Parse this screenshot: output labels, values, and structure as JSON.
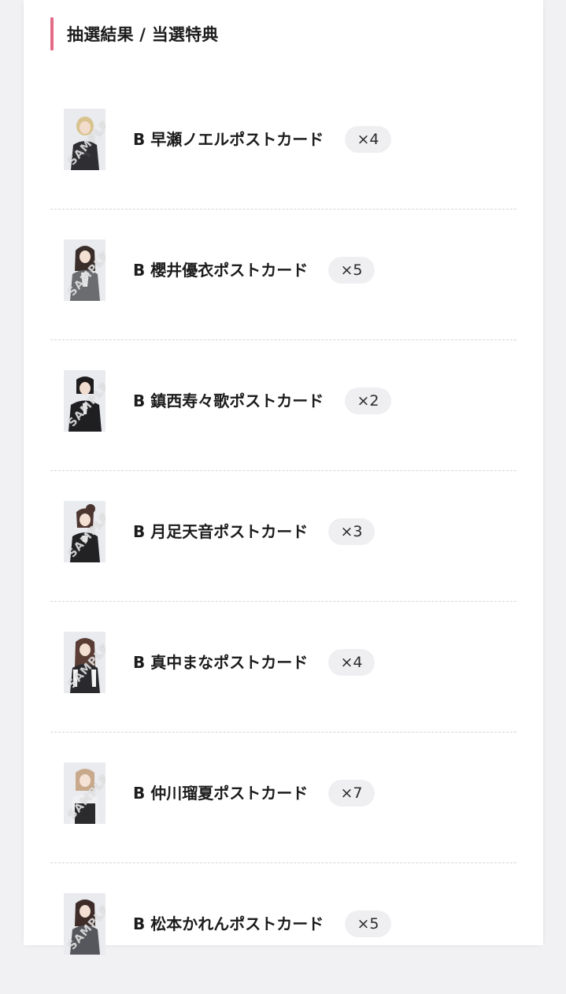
{
  "section": {
    "title": "抽選結果 / 当選特典",
    "accent_color": "#e46b86"
  },
  "items": [
    {
      "name": "B 早瀬ノエルポストカード",
      "quantity": "×4",
      "watermark": "SAMPLE",
      "photo_icon": "member-photo"
    },
    {
      "name": "B 櫻井優衣ポストカード",
      "quantity": "×5",
      "watermark": "SAMPLE",
      "photo_icon": "member-photo"
    },
    {
      "name": "B 鎮西寿々歌ポストカード",
      "quantity": "×2",
      "watermark": "SAMPLE",
      "photo_icon": "member-photo"
    },
    {
      "name": "B 月足天音ポストカード",
      "quantity": "×3",
      "watermark": "SAMPLE",
      "photo_icon": "member-photo"
    },
    {
      "name": "B 真中まなポストカード",
      "quantity": "×4",
      "watermark": "SAMPLE",
      "photo_icon": "member-photo"
    },
    {
      "name": "B 仲川瑠夏ポストカード",
      "quantity": "×7",
      "watermark": "SAMPLE",
      "photo_icon": "member-photo"
    },
    {
      "name": "B 松本かれんポストカード",
      "quantity": "×5",
      "watermark": "SAMPLE",
      "photo_icon": "member-photo"
    }
  ]
}
